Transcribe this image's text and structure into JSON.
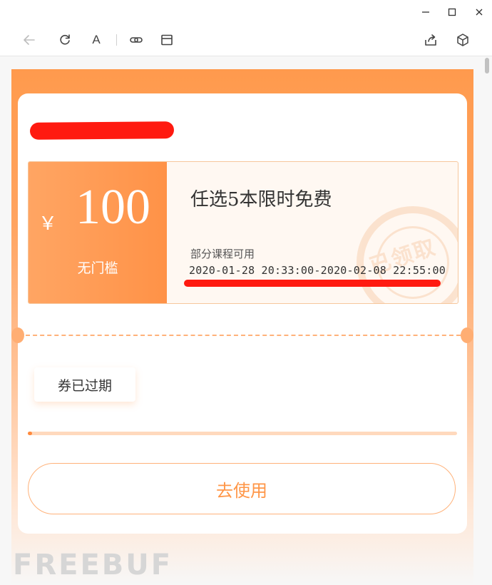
{
  "window": {
    "minimize_icon": "minimize-icon",
    "maximize_icon": "maximize-icon",
    "close_icon": "close-icon"
  },
  "toolbar": {
    "icons": [
      "back-arrow-icon",
      "refresh-icon",
      "font-icon",
      "link-icon",
      "window-icon",
      "share-icon",
      "cube-icon"
    ],
    "font_label": "A"
  },
  "coupon": {
    "currency": "￥",
    "amount": "100",
    "threshold": "无门槛",
    "title": "任选5本限时免费",
    "scope": "部分课程可用",
    "valid_period": "2020-01-28 20:33:00-2020-02-08 22:55:00",
    "stamp_text": "已领取"
  },
  "status": {
    "expired_label": "券已过期",
    "progress_fraction": 0.01
  },
  "action": {
    "use_label": "去使用"
  },
  "watermark": "FREEBUF",
  "colors": {
    "accent": "#ff9647",
    "redaction": "#ff1a10"
  }
}
